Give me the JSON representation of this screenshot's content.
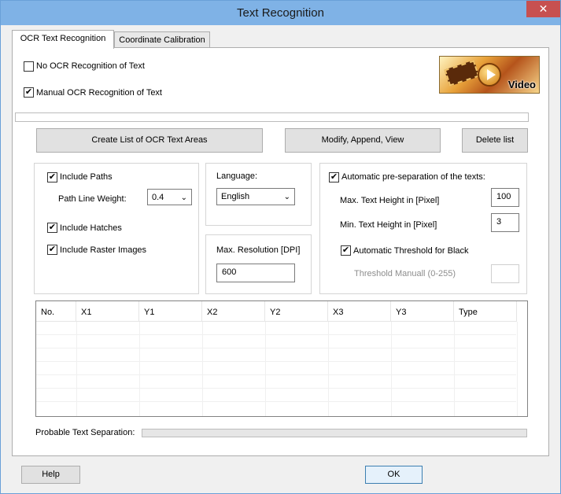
{
  "window": {
    "title": "Text Recognition",
    "close_glyph": "✕"
  },
  "tabs": [
    {
      "label": "OCR Text Recognition",
      "active": true
    },
    {
      "label": "Coordinate Calibration",
      "active": false
    }
  ],
  "ocr_mode": {
    "no_ocr_label": "No OCR Recognition of Text",
    "no_ocr_checked": false,
    "manual_ocr_label": "Manual OCR Recognition of Text",
    "manual_ocr_checked": true
  },
  "video": {
    "label": "Video"
  },
  "actions": {
    "create_list": "Create List of OCR Text Areas",
    "modify": "Modify, Append, View",
    "delete_list": "Delete list"
  },
  "options": {
    "include_paths": "Include Paths",
    "path_line_weight_label": "Path Line Weight:",
    "path_line_weight_value": "0.4",
    "include_hatches": "Include Hatches",
    "include_raster": "Include Raster Images"
  },
  "language": {
    "label": "Language:",
    "value": "English"
  },
  "resolution": {
    "label": "Max. Resolution [DPI]",
    "value": "600"
  },
  "preseparation": {
    "auto_label": "Automatic pre-separation of the texts:",
    "max_height_label": "Max. Text Height in [Pixel]",
    "max_height_value": "100",
    "min_height_label": "Min. Text Height in [Pixel]",
    "min_height_value": "3",
    "auto_threshold_label": "Automatic Threshold for Black",
    "threshold_manual_label": "Threshold Manuall (0-255)",
    "threshold_manual_value": ""
  },
  "table": {
    "columns": [
      "No.",
      "X1",
      "Y1",
      "X2",
      "Y2",
      "X3",
      "Y3",
      "Type"
    ],
    "rows": []
  },
  "separation": {
    "label": "Probable Text Separation:"
  },
  "footer": {
    "help": "Help",
    "ok": "OK"
  },
  "icons": {
    "check": "✔",
    "dropdown": "⌄"
  }
}
